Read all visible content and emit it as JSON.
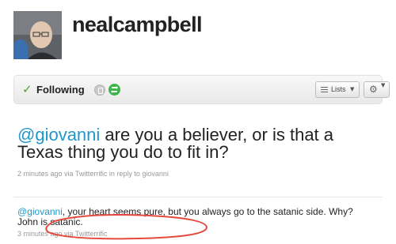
{
  "profile": {
    "username": "nealcampbell"
  },
  "toolbar": {
    "following_label": "Following",
    "lists_label": "Lists"
  },
  "main_tweet": {
    "mention": "@giovanni",
    "text": " are you a believer, or is that a Texas thing you do to fit in?",
    "meta": "2 minutes ago via Twitterrific in reply to giovanni"
  },
  "second_tweet": {
    "mention": "@giovanni",
    "text": ", your heart seems pure, but you always go to the satanic side. Why? John is satanic.",
    "meta": "3 minutes ago via Twitterrific"
  },
  "icons": {
    "check": "check-icon",
    "device": "device-icon",
    "retweet": "retweet-icon",
    "lists": "lists-icon",
    "gear": "gear-icon"
  },
  "colors": {
    "link": "#1f98c7",
    "check": "#4ca62f",
    "retweet": "#3cb64a",
    "annotation": "#e5483c",
    "meta": "#999999"
  }
}
